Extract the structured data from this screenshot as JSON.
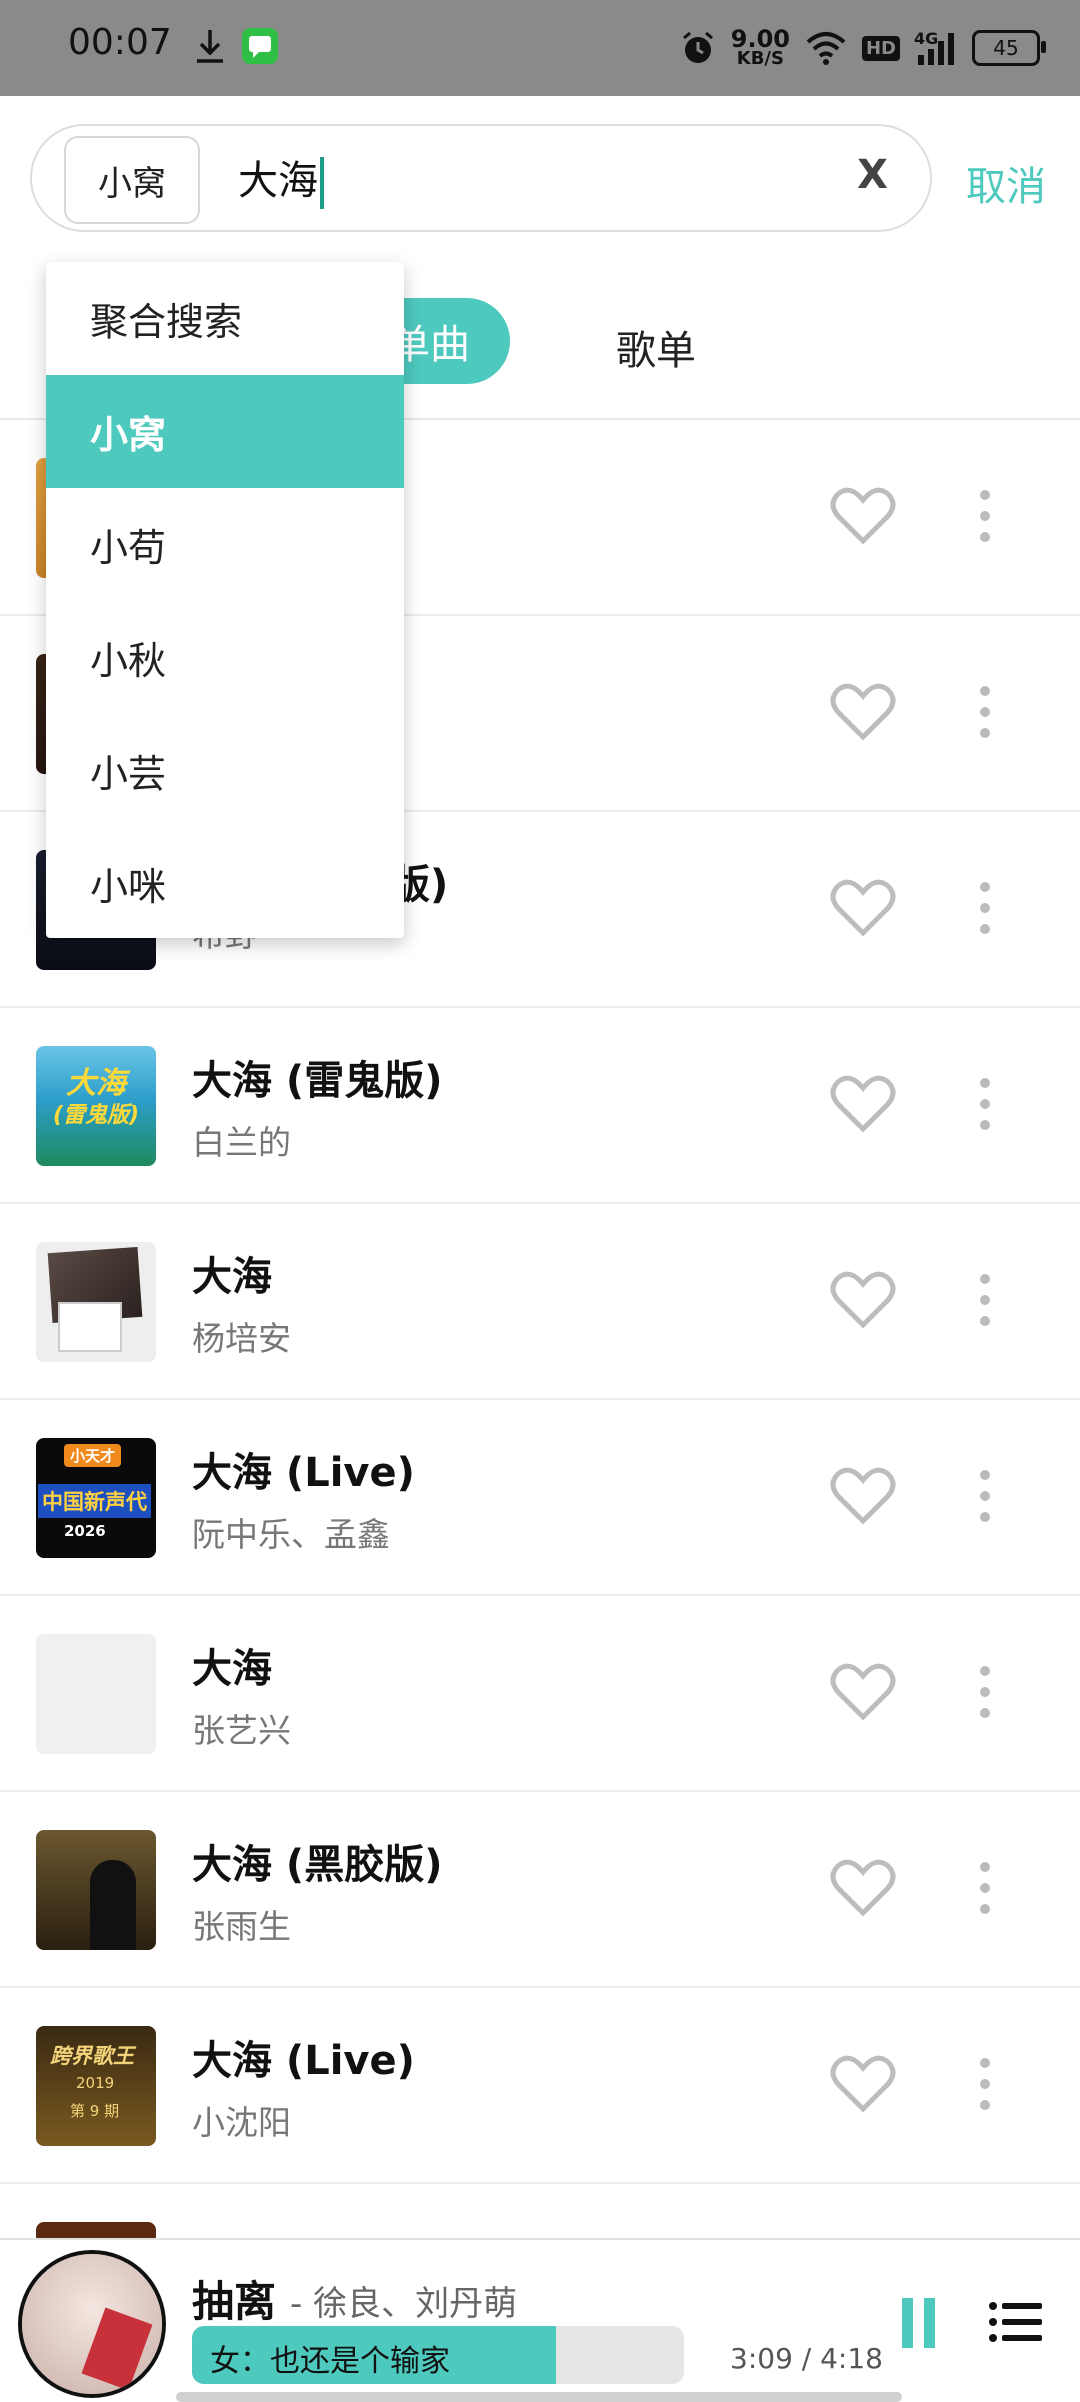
{
  "status_bar": {
    "time": "00:07",
    "net_speed_value": "9.00",
    "net_speed_unit": "KB/S",
    "hd": "HD",
    "network": "4G",
    "battery": "45"
  },
  "search": {
    "source": "小窝",
    "query": "大海",
    "clear_label": "X",
    "cancel_label": "取消"
  },
  "tabs": {
    "active": "单曲",
    "playlist": "歌单"
  },
  "source_menu": {
    "items": [
      {
        "label": "聚合搜索",
        "selected": false
      },
      {
        "label": "小窝",
        "selected": true
      },
      {
        "label": "小苟",
        "selected": false
      },
      {
        "label": "小秋",
        "selected": false
      },
      {
        "label": "小芸",
        "selected": false
      },
      {
        "label": "小咪",
        "selected": false
      }
    ]
  },
  "songs": [
    {
      "title": "",
      "artist": ""
    },
    {
      "title": "",
      "artist": ""
    },
    {
      "title": "版)",
      "artist": "希野"
    },
    {
      "title": "大海 (雷鬼版)",
      "artist": "白兰的"
    },
    {
      "title": "大海",
      "artist": "杨培安"
    },
    {
      "title": "大海 (Live)",
      "artist": "阮中乐、孟鑫"
    },
    {
      "title": "大海",
      "artist": "张艺兴"
    },
    {
      "title": "大海 (黑胶版)",
      "artist": "张雨生"
    },
    {
      "title": "大海 (Live)",
      "artist": "小沈阳"
    }
  ],
  "cover_art_text": {
    "reggae_line1": "大海",
    "reggae_line2": "(雷鬼版)",
    "live1_badge": "小天才",
    "live1_text": "中国新声代",
    "live1_year": "2026",
    "live2_text": "跨界歌王",
    "live2_year": "2019",
    "live2_episode": "第 9 期"
  },
  "player": {
    "title": "抽离",
    "artist": "- 徐良、刘丹萌",
    "lyric": "女：也还是个输家",
    "time": "3:09 / 4:18",
    "progress": 0.74
  },
  "colors": {
    "accent": "#4ec9be",
    "status_bar": "#8a8a8a",
    "icon_grey": "#bbbbbb"
  },
  "icons": {
    "status": [
      "download-icon",
      "message-icon",
      "alarm-icon",
      "wifi-icon",
      "signal-icon",
      "battery-icon"
    ],
    "row": [
      "heart-icon",
      "more-vertical-icon"
    ],
    "player": [
      "pause-icon",
      "playlist-icon"
    ]
  }
}
